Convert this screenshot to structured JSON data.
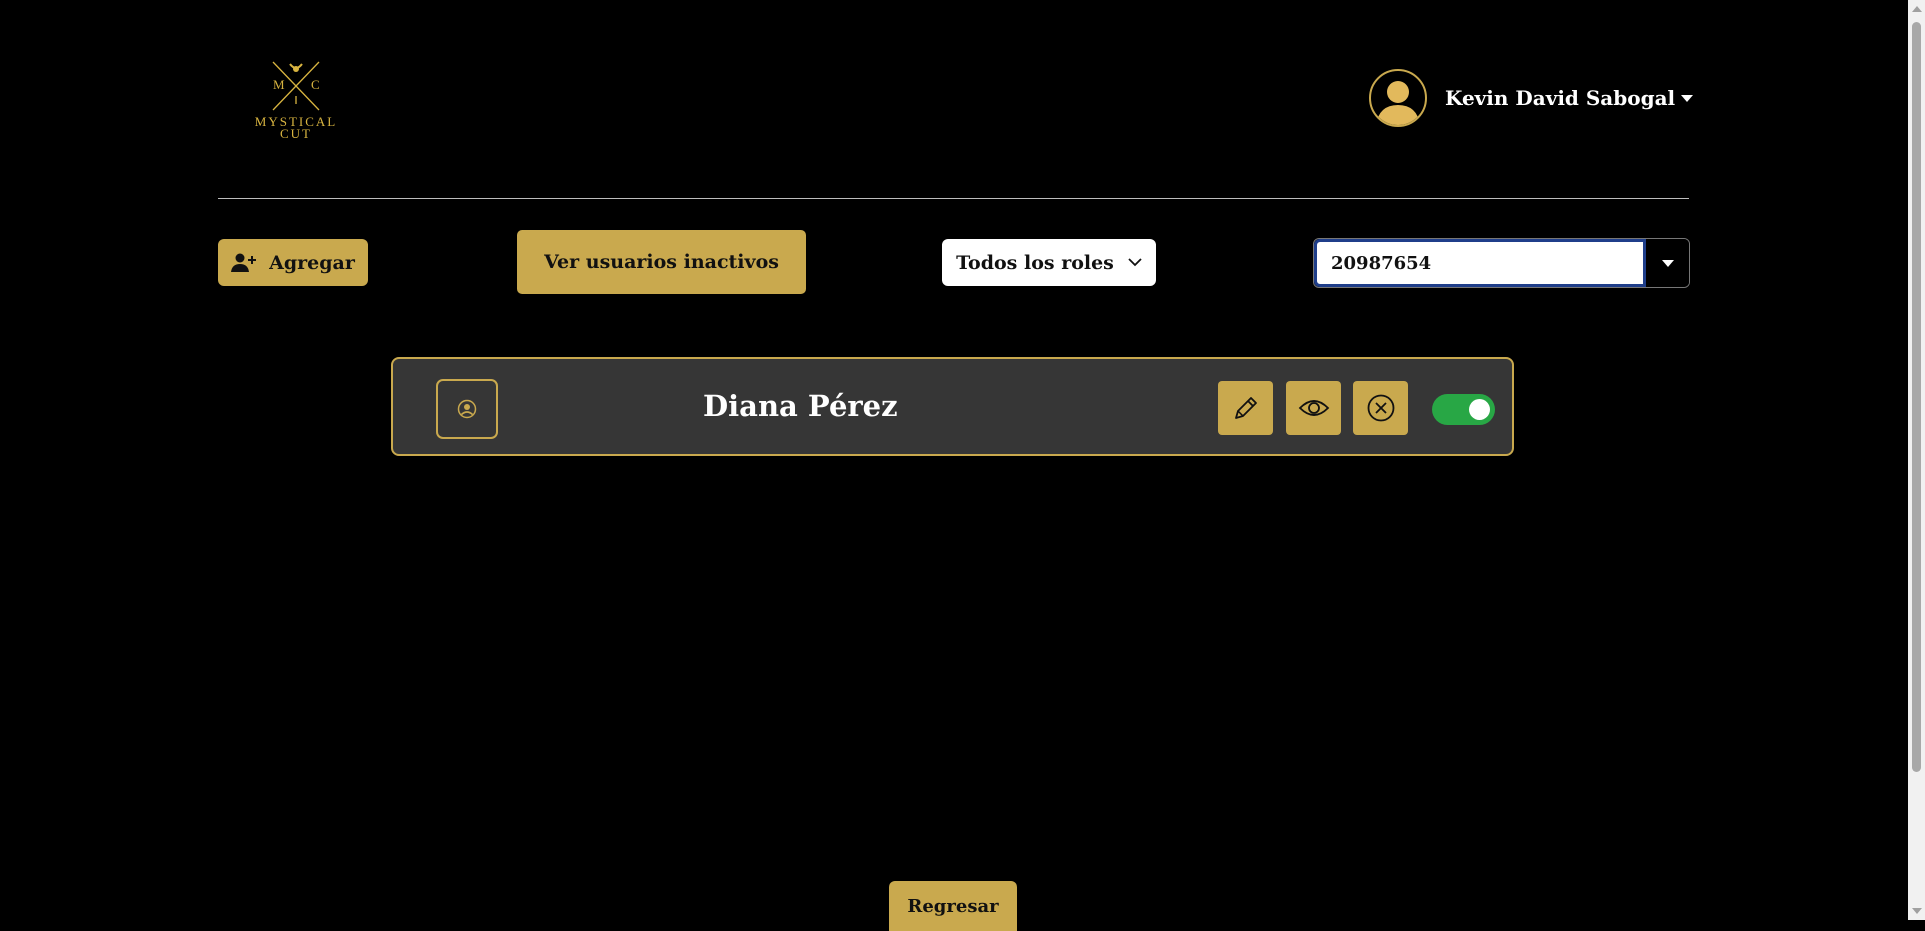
{
  "logo": {
    "initial_left": "M",
    "initial_right": "C",
    "line1": "MYSTICAL",
    "line2": "CUT"
  },
  "user": {
    "name": "Kevin David Sabogal",
    "avatar_icon": "user-avatar-icon"
  },
  "toolbar": {
    "add_label": "Agregar",
    "inactive_label": "Ver usuarios inactivos",
    "roles_label": "Todos los roles",
    "search_value": "20987654"
  },
  "users": [
    {
      "name": "Diana Pérez",
      "active": true
    }
  ],
  "footer": {
    "back_label": "Regresar"
  },
  "colors": {
    "gold": "#c9a94e",
    "background": "#000000",
    "card": "#363636",
    "toggle_on": "#28a745"
  }
}
